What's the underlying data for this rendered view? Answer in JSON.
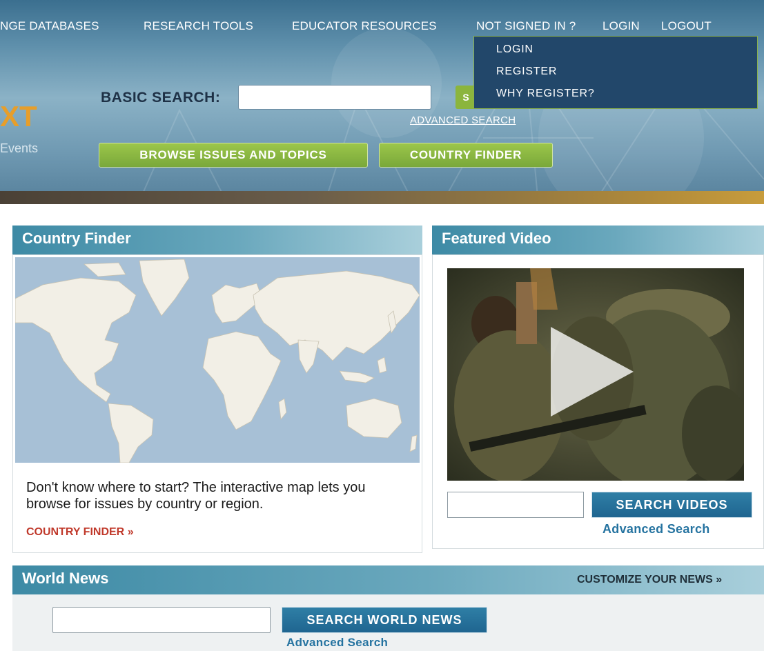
{
  "header": {
    "nav": [
      "NGE DATABASES",
      "RESEARCH TOOLS",
      "EDUCATOR RESOURCES",
      "NOT SIGNED IN ?",
      "LOGIN",
      "LOGOUT"
    ],
    "dropdown": [
      "LOGIN",
      "REGISTER",
      "WHY REGISTER?"
    ],
    "logo_text": "XT",
    "tagline": "Events",
    "search_label": "BASIC SEARCH:",
    "search_value": "",
    "go_label": "S",
    "advanced_search": "ADVANCED SEARCH",
    "browse_button": "BROWSE ISSUES AND TOPICS",
    "country_finder_button": "COUNTRY FINDER"
  },
  "country_finder": {
    "title": "Country Finder",
    "description": "Don't know where to start? The interactive map lets you browse for issues by country or region.",
    "link": "COUNTRY FINDER",
    "link_arrow": "»"
  },
  "featured_video": {
    "title": "Featured Video",
    "search_button": "SEARCH VIDEOS",
    "advanced": "Advanced Search"
  },
  "world_news": {
    "title": "World News",
    "customize": "CUSTOMIZE YOUR NEWS",
    "customize_arrow": "»",
    "search_button": "SEARCH WORLD NEWS",
    "advanced": "Advanced Search"
  },
  "icons": [
    "play-icon",
    "world-map"
  ],
  "colors": {
    "accent_green": "#8bb53d",
    "accent_blue": "#1f6590",
    "header_blue": "#3d8aa5",
    "dropdown_bg": "#22476a",
    "link_red": "#c0392b",
    "logo_orange": "#e79e2a",
    "ocean": "#a7c0d6",
    "land": "#f2efe6"
  }
}
